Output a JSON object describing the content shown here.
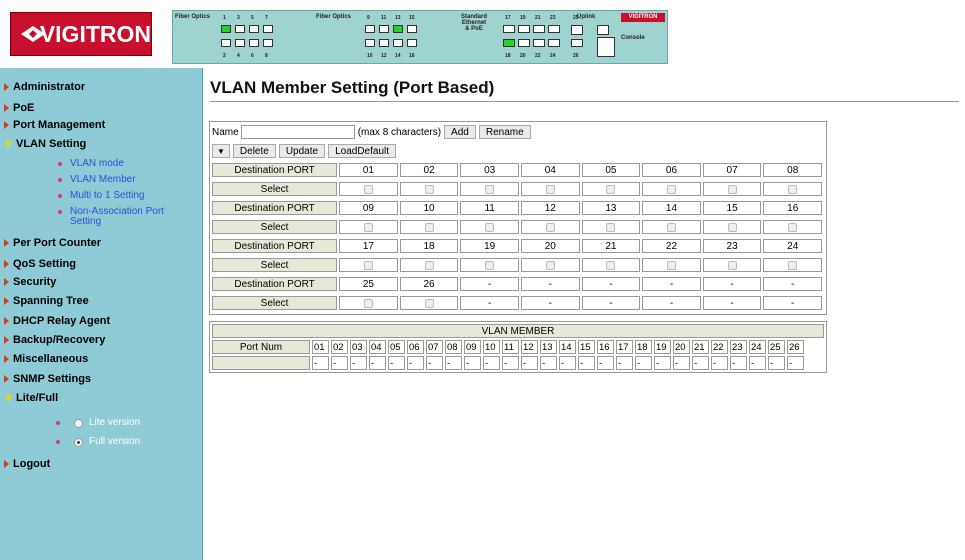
{
  "header": {
    "logo_text": "VIGITRON",
    "panel": {
      "fiber_optics_label": "Fiber Optics",
      "standard_label": "Standard\nEthernet\n& PoE",
      "uplink_label": "Uplink",
      "console_label": "Console",
      "mini_logo": "VIGITRON",
      "port_numbers_top_left": [
        "1",
        "3",
        "5",
        "7"
      ],
      "port_numbers_bottom_left": [
        "2",
        "4",
        "6",
        "8"
      ],
      "port_numbers_top_mid": [
        "9",
        "11",
        "13",
        "15"
      ],
      "port_numbers_bottom_mid": [
        "10",
        "12",
        "14",
        "16"
      ],
      "port_numbers_top_right": [
        "17",
        "19",
        "21",
        "23",
        "25",
        "25"
      ],
      "port_numbers_bottom_right": [
        "18",
        "20",
        "22",
        "24",
        "26",
        "26"
      ]
    }
  },
  "sidebar": {
    "items": [
      {
        "label": "Administrator"
      },
      {
        "label": "PoE"
      },
      {
        "label": "Port Management"
      },
      {
        "label": "VLAN Setting"
      },
      {
        "label": "Per Port Counter"
      },
      {
        "label": "QoS Setting"
      },
      {
        "label": "Security"
      },
      {
        "label": "Spanning Tree"
      },
      {
        "label": "DHCP Relay Agent"
      },
      {
        "label": "Backup/Recovery"
      },
      {
        "label": "Miscellaneous"
      },
      {
        "label": "SNMP Settings"
      },
      {
        "label": "Lite/Full"
      },
      {
        "label": "Logout"
      }
    ],
    "vlan_sub": [
      "VLAN mode",
      "VLAN Member",
      "Multi to 1 Setting",
      "Non-Association Port Setting"
    ],
    "lite_full_options": [
      {
        "label": "Lite version",
        "selected": false
      },
      {
        "label": "Full version",
        "selected": true
      }
    ]
  },
  "main": {
    "title": "VLAN Member Setting (Port Based)",
    "form": {
      "name_label": "Name",
      "name_value": "",
      "max_hint": "(max 8 characters)",
      "add_button": "Add",
      "rename_button": "Rename",
      "dropdown_value": "▼",
      "delete_button": "Delete",
      "update_button": "Update",
      "loaddefault_button": "LoadDefault",
      "dest_port_label": "Destination PORT",
      "select_label": "Select",
      "port_groups": [
        [
          "01",
          "02",
          "03",
          "04",
          "05",
          "06",
          "07",
          "08"
        ],
        [
          "09",
          "10",
          "11",
          "12",
          "13",
          "14",
          "15",
          "16"
        ],
        [
          "17",
          "18",
          "19",
          "20",
          "21",
          "22",
          "23",
          "24"
        ],
        [
          "25",
          "26",
          "-",
          "-",
          "-",
          "-",
          "-",
          "-"
        ]
      ]
    },
    "member": {
      "header": "VLAN MEMBER",
      "port_num_label": "Port Num",
      "ports": [
        "01",
        "02",
        "03",
        "04",
        "05",
        "06",
        "07",
        "08",
        "09",
        "10",
        "11",
        "12",
        "13",
        "14",
        "15",
        "16",
        "17",
        "18",
        "19",
        "20",
        "21",
        "22",
        "23",
        "24",
        "25",
        "26"
      ],
      "values": [
        "-",
        "-",
        "-",
        "-",
        "-",
        "-",
        "-",
        "-",
        "-",
        "-",
        "-",
        "-",
        "-",
        "-",
        "-",
        "-",
        "-",
        "-",
        "-",
        "-",
        "-",
        "-",
        "-",
        "-",
        "-",
        "-"
      ]
    }
  }
}
